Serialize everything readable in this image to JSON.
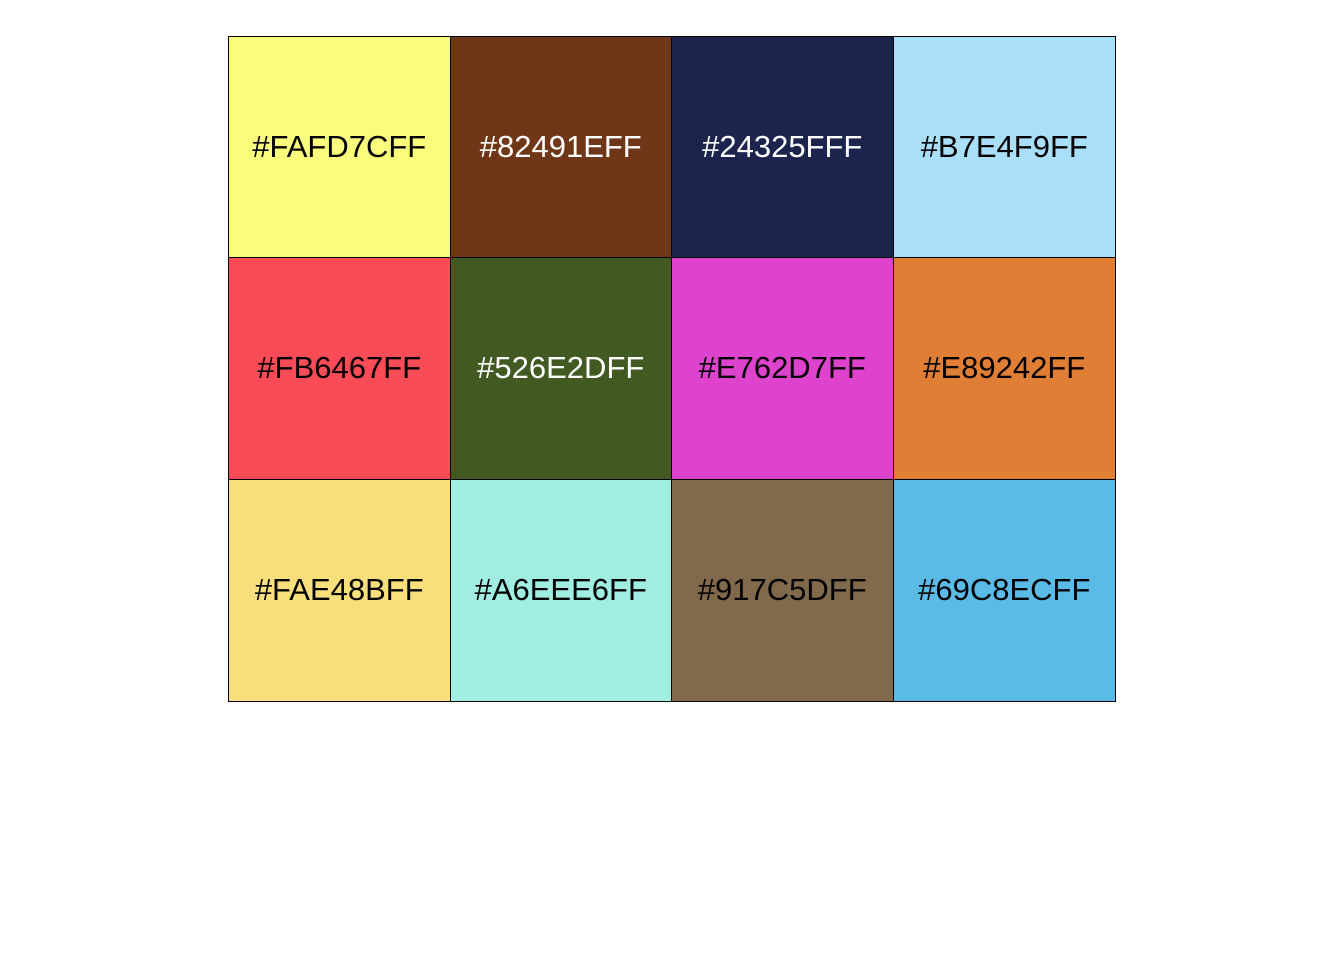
{
  "swatches": [
    {
      "label": "#FAFD7CFF",
      "color": "#FAFD7C",
      "text_color": "#000000"
    },
    {
      "label": "#82491EFF",
      "color": "#6F3718",
      "text_color": "#FFFFFF"
    },
    {
      "label": "#24325FFF",
      "color": "#1C244E",
      "text_color": "#FFFFFF"
    },
    {
      "label": "#B7E4F9FF",
      "color": "#AADFF9",
      "text_color": "#000000"
    },
    {
      "label": "#FB6467FF",
      "color": "#F94C57",
      "text_color": "#000000"
    },
    {
      "label": "#526E2DFF",
      "color": "#425A22",
      "text_color": "#FFFFFF"
    },
    {
      "label": "#E762D7FF",
      "color": "#DD43CD",
      "text_color": "#000000"
    },
    {
      "label": "#E89242FF",
      "color": "#E07E35",
      "text_color": "#000000"
    },
    {
      "label": "#FAE48BFF",
      "color": "#F8DF7B",
      "text_color": "#000000"
    },
    {
      "label": "#A6EEE6FF",
      "color": "#9FEEE1",
      "text_color": "#000000"
    },
    {
      "label": "#917C5DFF",
      "color": "#81694C",
      "text_color": "#000000"
    },
    {
      "label": "#69C8ECFF",
      "color": "#5ABCE6",
      "text_color": "#000000"
    }
  ]
}
